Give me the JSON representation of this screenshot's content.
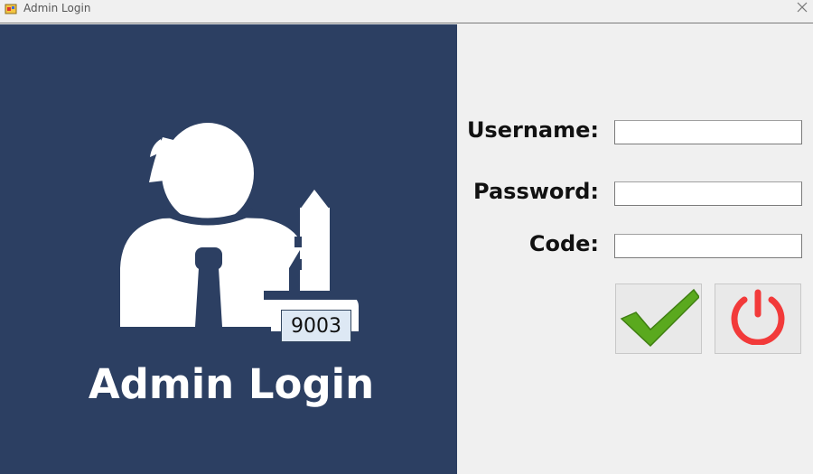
{
  "window": {
    "title": "Admin Login",
    "close_icon": "close-icon",
    "app_icon": "app-icon"
  },
  "hero": {
    "code": "9003",
    "title": "Admin Login",
    "icon": "admin-key-icon"
  },
  "form": {
    "username_label": "Username:",
    "password_label": "Password:",
    "code_label": "Code:",
    "username_value": "",
    "password_value": "",
    "code_value": ""
  },
  "actions": {
    "confirm_icon": "checkmark-icon",
    "exit_icon": "power-icon"
  },
  "colors": {
    "panel": "#2c3f62",
    "check": "#5aa91e",
    "power": "#f23a3a"
  }
}
